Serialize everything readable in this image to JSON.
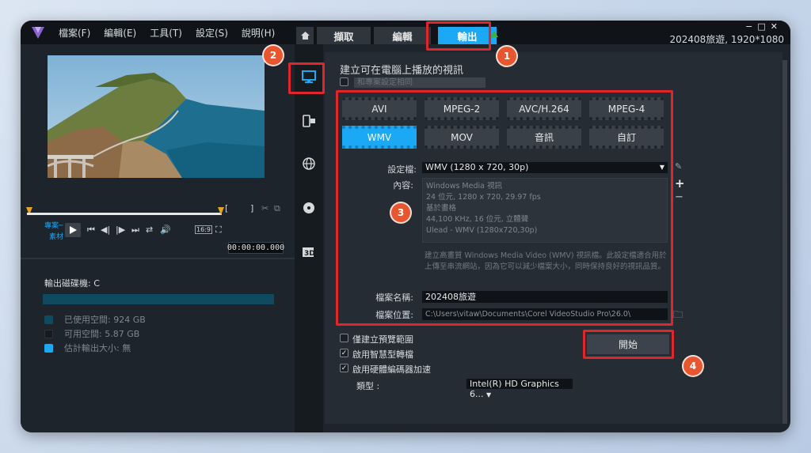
{
  "menubar": {
    "items": [
      "檔案(F)",
      "編輯(E)",
      "工具(T)",
      "設定(S)",
      "說明(H)"
    ],
    "project_info": "202408旅遊, 1920*1080"
  },
  "tabs": {
    "capture": "擷取",
    "edit": "編輯",
    "share": "輸出"
  },
  "player": {
    "mode_label": "專案─",
    "aspect": "16:9",
    "timecode": "00:00:00.000",
    "bracket_in": "[",
    "bracket_out": "]"
  },
  "disk": {
    "label": "輸出磁碟機: C",
    "used": "已使用空間: 924 GB",
    "free": "可用空間: 5.87 GB",
    "estimate": "估計輸出大小: 無",
    "colors": {
      "used": "#0f4a5e",
      "free": "#1e242b",
      "estimate": "#1ba8f5"
    }
  },
  "share": {
    "heading": "建立可在電腦上播放的視訊",
    "match_project": "和專案設定相同",
    "formats": [
      "AVI",
      "MPEG-2",
      "AVC/H.264",
      "MPEG-4",
      "WMV",
      "MOV",
      "音訊",
      "自訂"
    ],
    "selected_format": "WMV",
    "profile_label": "設定檔:",
    "profile_value": "WMV (1280 x 720, 30p)",
    "content_label": "內容:",
    "content_lines": [
      "Windows Media 視訊",
      "24 位元, 1280 x 720, 29.97 fps",
      "基於畫格",
      "44,100 KHz, 16 位元, 立體聲",
      "Ulead - WMV (1280x720,30p)"
    ],
    "description": "建立高畫質 Windows Media Video (WMV) 視訊檔。此設定檔適合用於上傳至串流網站，因為它可以減少檔案大小，同時保持良好的視訊品質。",
    "filename_label": "檔案名稱:",
    "filename_value": "202408旅遊",
    "location_label": "檔案位置:",
    "location_value": "C:\\Users\\vitaw\\Documents\\Corel VideoStudio Pro\\26.0\\",
    "opt_preview": "僅建立預覽範圍",
    "opt_smart": "啟用智慧型轉檔",
    "opt_hw": "啟用硬體編碼器加速",
    "type_label": "類型 :",
    "gpu_value": "Intel(R) HD Graphics 6...",
    "start_button": "開始",
    "checked": {
      "preview": false,
      "smart": true,
      "hw": true
    }
  },
  "badges": [
    "1",
    "2",
    "3",
    "4"
  ],
  "colors": {
    "accent": "#1ba8f5",
    "highlight": "#e0262b",
    "badge": "#e8562f"
  }
}
